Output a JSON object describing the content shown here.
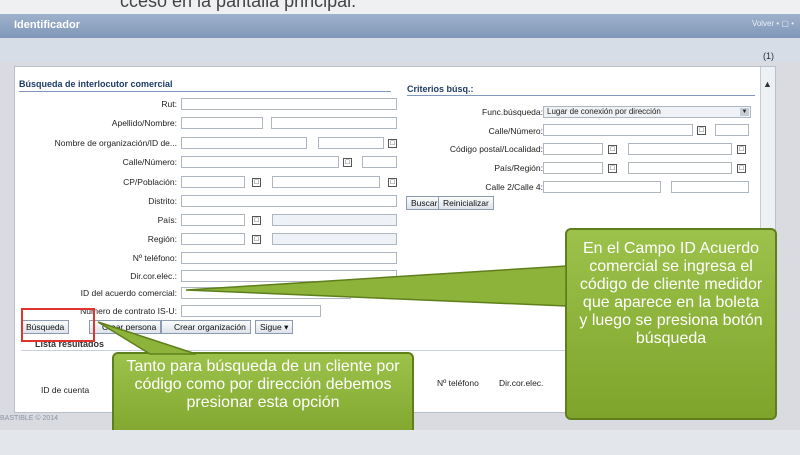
{
  "top_cut_text": "cceso en la pantalla principal.",
  "window": {
    "title": "Identificador",
    "tools": "Volver • ▢ •",
    "result_count": "(1)"
  },
  "search": {
    "section_title": "Búsqueda de interlocutor comercial",
    "fields": {
      "rut": "Rut:",
      "apellido": "Apellido/Nombre:",
      "organizacion": "Nombre de organización/ID de...",
      "calle": "Calle/Número:",
      "cp": "CP/Población:",
      "distrito": "Distrito:",
      "pais": "País:",
      "region": "Región:",
      "telefono": "Nº teléfono:",
      "dircor": "Dir.cor.elec.:",
      "id_acuerdo": "ID del acuerdo comercial:",
      "contrato": "Número de contrato IS-U:"
    }
  },
  "criteria": {
    "section_title": "Criterios búsq.:",
    "func_label": "Func.búsqueda:",
    "func_value": "Lugar de conexión por dirección",
    "calle_label": "Calle/Número:",
    "cp_label": "Código postal/Localidad:",
    "pais_label": "País/Región:",
    "calle2_label": "Calle 2/Calle 4:"
  },
  "buttons": {
    "buscar": "Buscar",
    "reiniciar": "Reinicializar",
    "busqueda": "Búsqueda",
    "crear_persona": "Crear persona",
    "crear_org": "Crear organización",
    "sigue": "Sigue"
  },
  "results": {
    "title": "Lista resultados",
    "col_id_cuenta": "ID de cuenta",
    "col_telefono": "Nº teléfono",
    "col_dircor": "Dir.cor.elec."
  },
  "callouts": {
    "right": "En el Campo ID Acuerdo comercial se ingresa el código de cliente medidor que aparece en la boleta y luego se presiona botón búsqueda",
    "left": "Tanto para búsqueda de un cliente por código como por dirección debemos presionar esta opción"
  },
  "footer_text": "BASTIBLE © 2014",
  "colors": {
    "accent": "#7f97b8",
    "callout": "#8db33a",
    "highlight": "#e0342c"
  }
}
